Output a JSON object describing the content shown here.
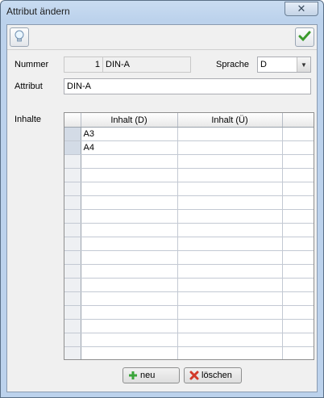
{
  "window": {
    "title": "Attribut ändern",
    "close_glyph": "✕"
  },
  "toolbar": {
    "hint_icon": "lightbulb-icon",
    "ok_icon": "checkmark-icon"
  },
  "form": {
    "nummer_label": "Nummer",
    "nummer_value": "1",
    "nummer_code": "DIN-A",
    "sprache_label": "Sprache",
    "sprache_value": "D",
    "attribut_label": "Attribut",
    "attribut_value": "DIN-A",
    "inhalte_label": "Inhalte"
  },
  "grid": {
    "columns": [
      "Inhalt (D)",
      "Inhalt (Ü)"
    ],
    "rows": [
      [
        "A3",
        ""
      ],
      [
        "A4",
        ""
      ],
      [
        "",
        ""
      ],
      [
        "",
        ""
      ],
      [
        "",
        ""
      ],
      [
        "",
        ""
      ],
      [
        "",
        ""
      ],
      [
        "",
        ""
      ],
      [
        "",
        ""
      ],
      [
        "",
        ""
      ],
      [
        "",
        ""
      ],
      [
        "",
        ""
      ],
      [
        "",
        ""
      ],
      [
        "",
        ""
      ],
      [
        "",
        ""
      ],
      [
        "",
        ""
      ],
      [
        "",
        ""
      ]
    ]
  },
  "buttons": {
    "neu": "neu",
    "loeschen": "löschen"
  },
  "colors": {
    "add_green": "#3aa53a",
    "delete_red": "#d23a2a",
    "check_green": "#3b9a2b"
  }
}
